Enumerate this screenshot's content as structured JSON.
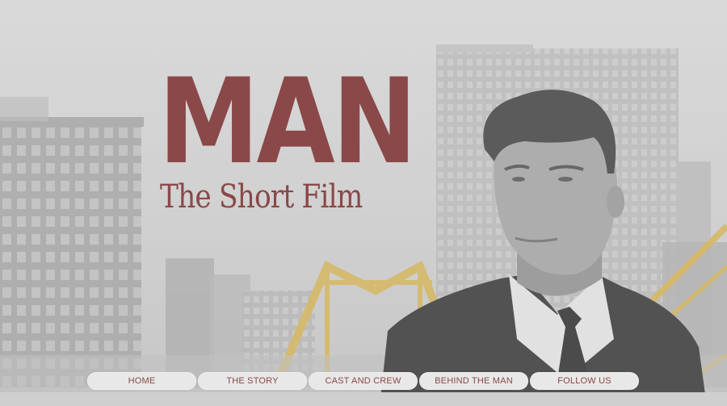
{
  "title": {
    "main": "MAN",
    "subtitle": "The Short Film"
  },
  "nav": {
    "items": [
      {
        "label": "HOME"
      },
      {
        "label": "THE STORY"
      },
      {
        "label": "CAST AND CREW"
      },
      {
        "label": "BEHIND THE MAN"
      },
      {
        "label": "FOLLOW US"
      }
    ]
  },
  "colors": {
    "title": "#8a4848",
    "nav_bg": "#e8e8e8",
    "bridge": "#d8b24a"
  }
}
